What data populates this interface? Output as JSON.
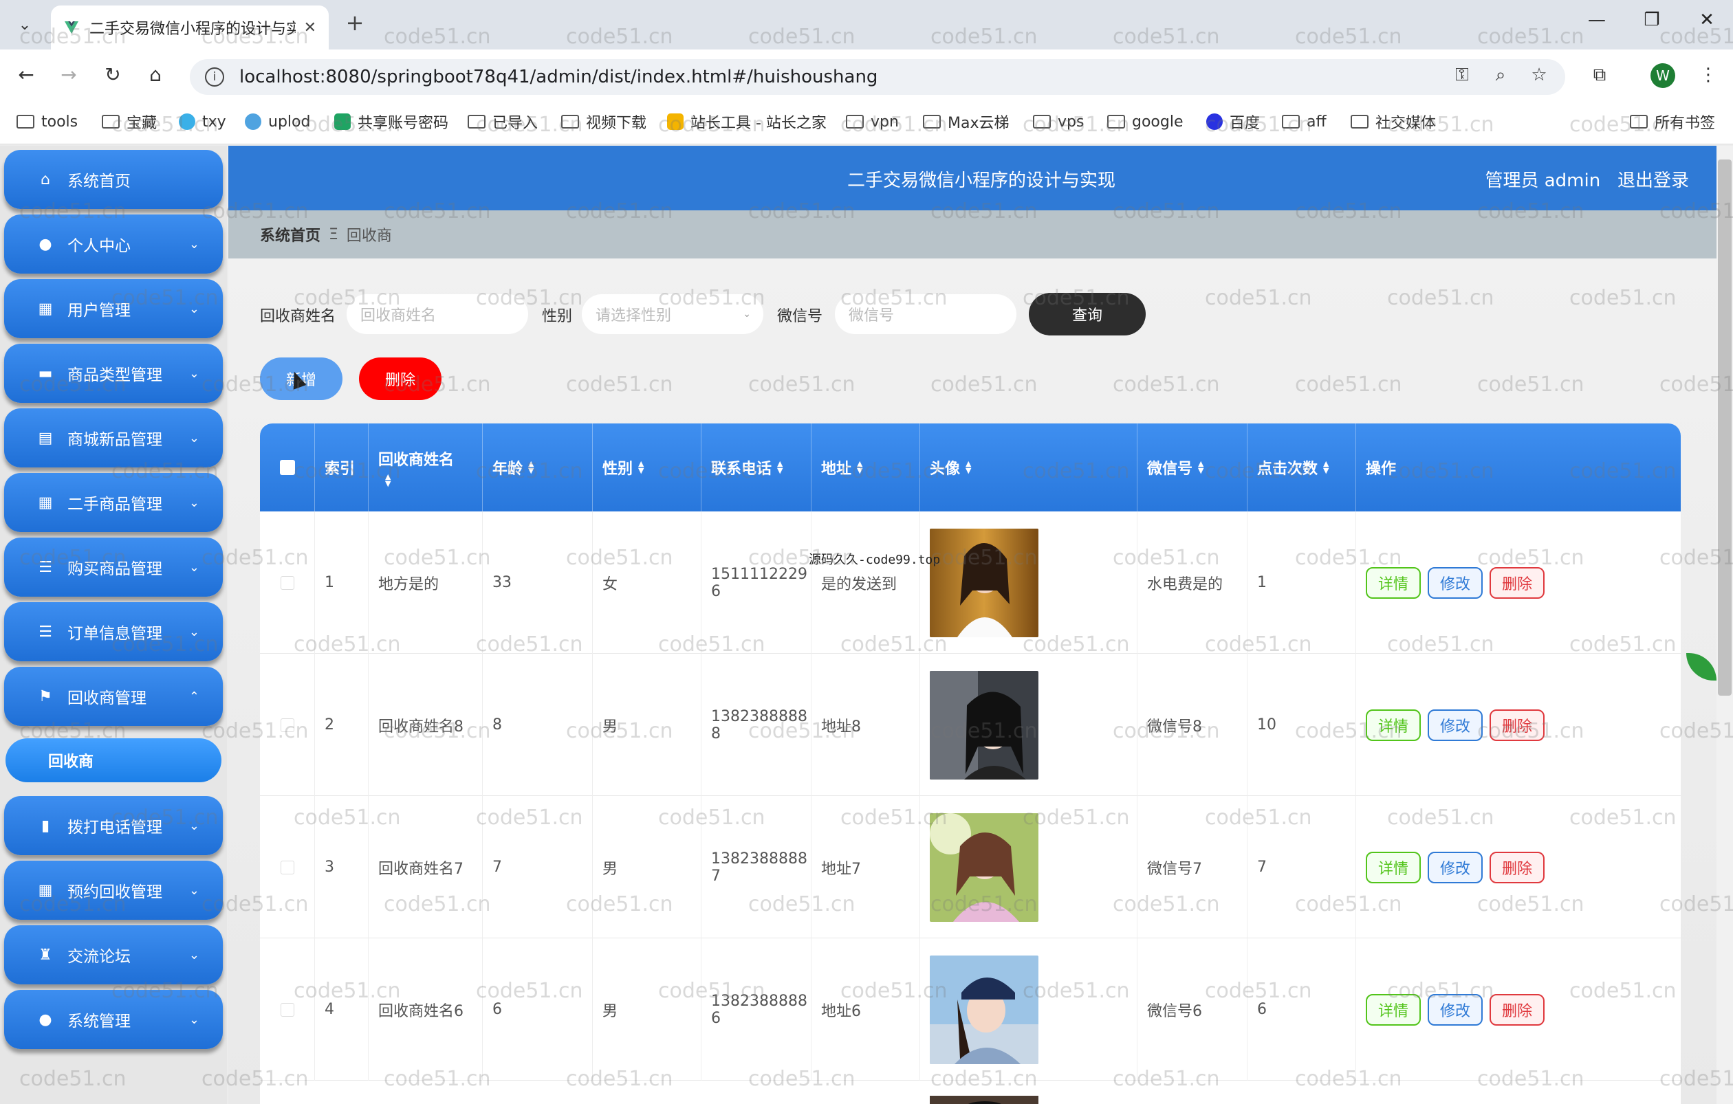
{
  "browser": {
    "tab_title": "二手交易微信小程序的设计与实",
    "url": "localhost:8080/springboot78q41/admin/dist/index.html#/huishoushang",
    "profile_initial": "W",
    "bookmarks": [
      "tools",
      "宝藏",
      "txy",
      "uplod",
      "共享账号密码",
      "已导入",
      "视频下载",
      "站长工具 - 站长之家",
      "vpn",
      "Max云梯",
      "vps",
      "google",
      "百度",
      "aff",
      "社交媒体"
    ],
    "all_bookmarks": "所有书签"
  },
  "header": {
    "title": "二手交易微信小程序的设计与实现",
    "admin": "管理员 admin",
    "logout": "退出登录"
  },
  "breadcrumb": {
    "home": "系统首页",
    "sep": "Ξ",
    "current": "回收商"
  },
  "sidebar": {
    "items": [
      {
        "label": "系统首页",
        "icon": "home-icon"
      },
      {
        "label": "个人中心",
        "icon": "user-icon"
      },
      {
        "label": "用户管理",
        "icon": "grid-icon"
      },
      {
        "label": "商品类型管理",
        "icon": "chat-icon"
      },
      {
        "label": "商城新品管理",
        "icon": "clipboard-icon"
      },
      {
        "label": "二手商品管理",
        "icon": "grid-icon"
      },
      {
        "label": "购买商品管理",
        "icon": "list-icon"
      },
      {
        "label": "订单信息管理",
        "icon": "list-icon"
      },
      {
        "label": "回收商管理",
        "icon": "flag-icon"
      },
      {
        "label": "拨打电话管理",
        "icon": "chart-icon"
      },
      {
        "label": "预约回收管理",
        "icon": "grid-icon"
      },
      {
        "label": "交流论坛",
        "icon": "trophy-icon"
      },
      {
        "label": "系统管理",
        "icon": "user-icon"
      }
    ],
    "sub_item": "回收商"
  },
  "search": {
    "name_label": "回收商姓名",
    "name_placeholder": "回收商姓名",
    "gender_label": "性别",
    "gender_placeholder": "请选择性别",
    "wechat_label": "微信号",
    "wechat_placeholder": "微信号",
    "query_button": "查询"
  },
  "actions": {
    "add": "新增",
    "delete": "删除"
  },
  "table": {
    "headers": [
      "索引",
      "回收商姓名",
      "年龄",
      "性别",
      "联系电话",
      "地址",
      "头像",
      "微信号",
      "点击次数",
      "操作"
    ],
    "rows": [
      {
        "index": "1",
        "name": "地方是的",
        "age": "33",
        "gender": "女",
        "phone_l1": "1511112229",
        "phone_l2": "6",
        "address": "是的发送到",
        "wechat": "水电费是的",
        "clicks": "1"
      },
      {
        "index": "2",
        "name": "回收商姓名8",
        "age": "8",
        "gender": "男",
        "phone_l1": "1382388888",
        "phone_l2": "8",
        "address": "地址8",
        "wechat": "微信号8",
        "clicks": "10"
      },
      {
        "index": "3",
        "name": "回收商姓名7",
        "age": "7",
        "gender": "男",
        "phone_l1": "1382388888",
        "phone_l2": "7",
        "address": "地址7",
        "wechat": "微信号7",
        "clicks": "7"
      },
      {
        "index": "4",
        "name": "回收商姓名6",
        "age": "6",
        "gender": "男",
        "phone_l1": "1382388888",
        "phone_l2": "6",
        "address": "地址6",
        "wechat": "微信号6",
        "clicks": "6"
      }
    ],
    "op_detail": "详情",
    "op_edit": "修改",
    "op_delete": "删除"
  },
  "overlay_note": "源码久久-code99.top",
  "watermark": "code51.cn",
  "colors": {
    "primary": "#2f7ad6",
    "danger": "#ff0000",
    "dark": "#2d2d2d"
  }
}
